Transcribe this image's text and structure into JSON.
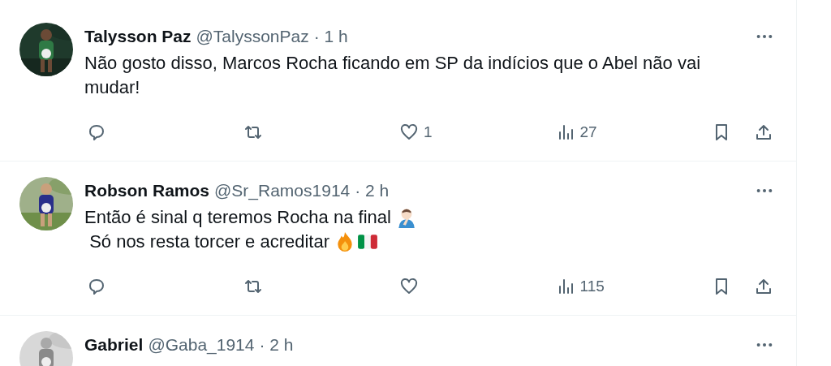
{
  "tweets": [
    {
      "name": "Talysson Paz",
      "handle": "@TalyssonPaz",
      "time": "· 1 h",
      "avatar": {
        "kind": "picture"
      },
      "lines": [
        {
          "text": "Não gosto disso, Marcos Rocha ficando em SP da indícios que o Abel não vai mudar!"
        }
      ],
      "actions": {
        "like_count": "1",
        "views": "27"
      }
    },
    {
      "name": "Robson Ramos",
      "handle": "@Sr_Ramos1914",
      "time": "· 2 h",
      "avatar": {
        "kind": "picture"
      },
      "lines": [
        {
          "text": "Então é sinal q teremos Rocha na final",
          "emoji": [
            {
              "kind": "facepalm"
            }
          ]
        },
        {
          "text": " Só nos resta torcer e acreditar",
          "emoji": [
            {
              "kind": "fire"
            },
            {
              "kind": "flag"
            }
          ]
        }
      ],
      "actions": {
        "views": "115"
      }
    },
    {
      "name": "Gabriel",
      "handle": "@Gaba_1914",
      "time": "· 2 h",
      "avatar": {
        "kind": "picture"
      }
    }
  ]
}
